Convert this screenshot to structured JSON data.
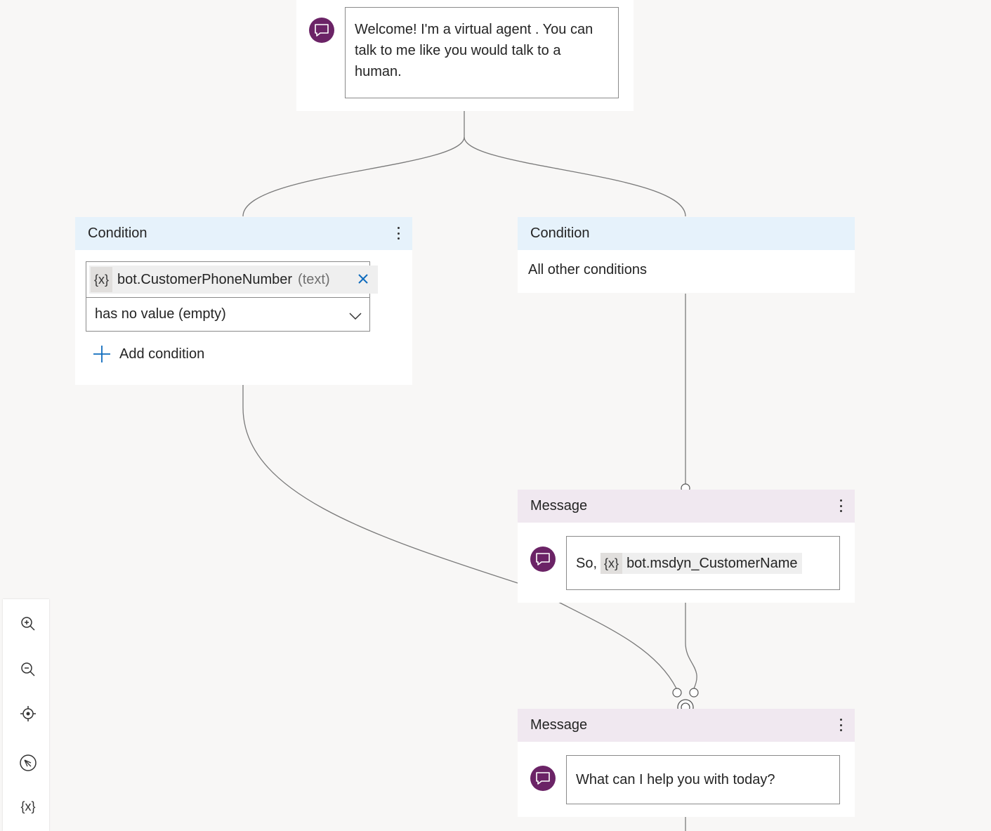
{
  "welcome": {
    "text": "Welcome! I'm a virtual agent . You can talk to me like you would talk to a human."
  },
  "condition_left": {
    "header": "Condition",
    "variable_badge": "{x}",
    "variable_name": "bot.CustomerPhoneNumber",
    "variable_type": "(text)",
    "operator": "has no value (empty)",
    "add_condition_label": "Add condition"
  },
  "condition_right": {
    "header": "Condition",
    "text": "All other conditions"
  },
  "message_1": {
    "header": "Message",
    "prefix": "So,",
    "variable_badge": "{x}",
    "variable_name": "bot.msdyn_CustomerName"
  },
  "message_2": {
    "header": "Message",
    "text": "What can I help you with today?"
  },
  "toolbar": {
    "variables_label": "{x}",
    "icons": [
      "zoom-in-icon",
      "zoom-out-icon",
      "recenter-icon",
      "minimap-icon",
      "variables-icon"
    ]
  },
  "colors": {
    "canvas": "#f8f7f6",
    "avatar": "#6b2366",
    "condition_header": "#e6f2fb",
    "message_header": "#f0e8f0",
    "accent": "#0f6cbd"
  }
}
